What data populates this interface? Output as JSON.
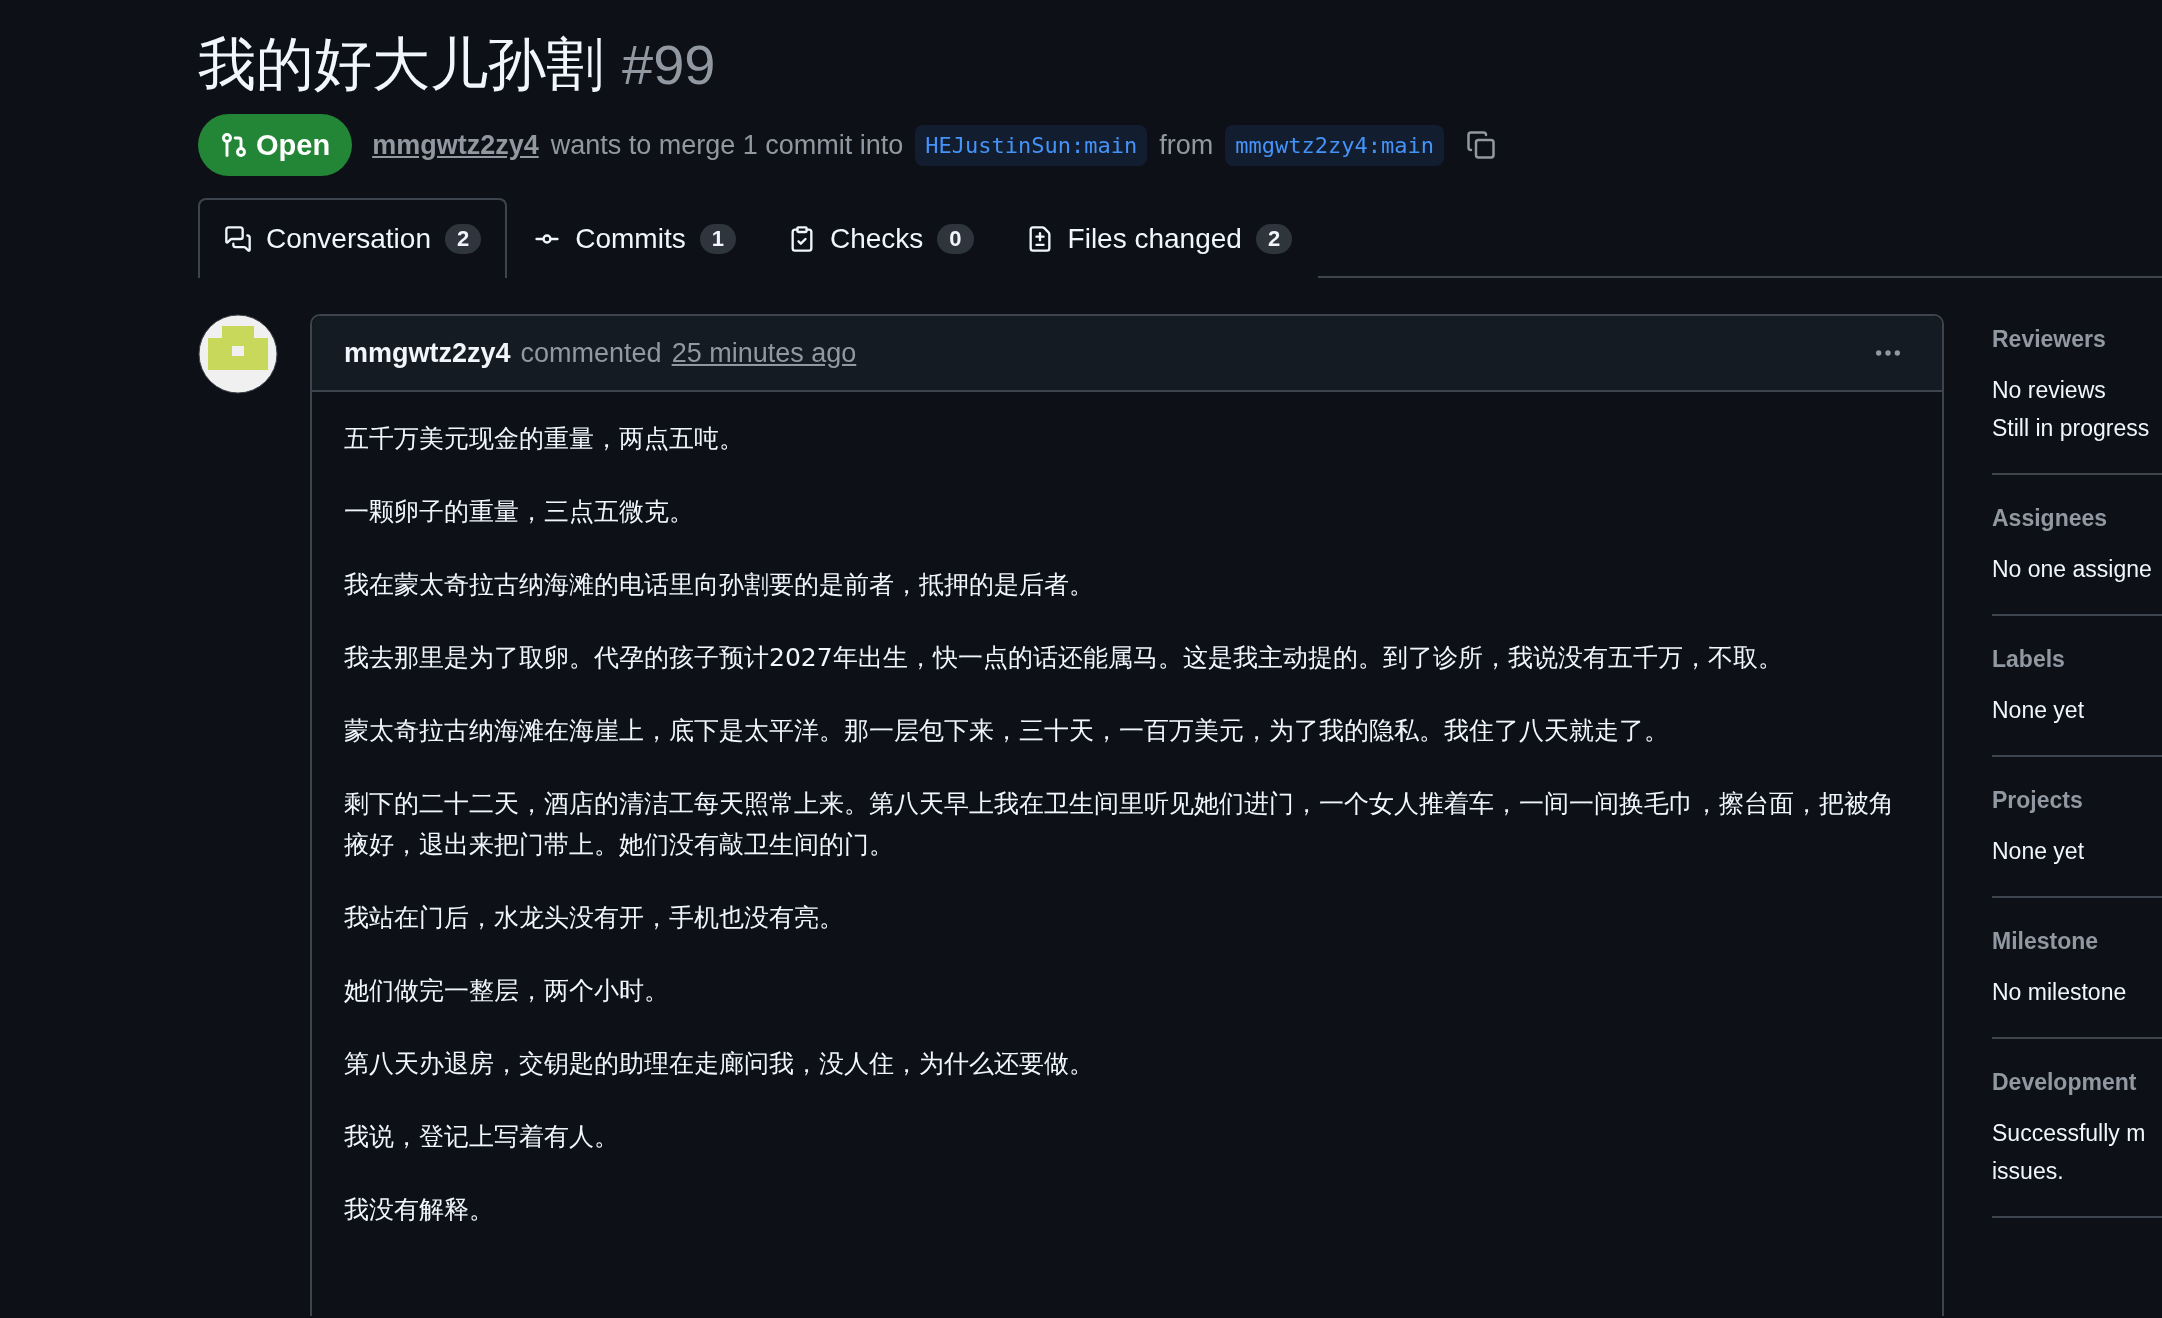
{
  "pull_request": {
    "title": "我的好大儿孙割",
    "number": "#99",
    "state": "Open",
    "author": "mmgwtz2zy4",
    "summary": "wants to merge 1 commit into",
    "base_branch": "HEJustinSun:main",
    "from_label": "from",
    "head_branch": "mmgwtz2zy4:main"
  },
  "tabs": [
    {
      "kind": "conversation",
      "label": "Conversation",
      "count": "2",
      "selected": true
    },
    {
      "kind": "commits",
      "label": "Commits",
      "count": "1",
      "selected": false
    },
    {
      "kind": "checks",
      "label": "Checks",
      "count": "0",
      "selected": false
    },
    {
      "kind": "files",
      "label": "Files changed",
      "count": "2",
      "selected": false
    }
  ],
  "comment": {
    "author": "mmgwtz2zy4",
    "action": "commented",
    "time": "25 minutes ago",
    "paragraphs": [
      "五千万美元现金的重量，两点五吨。",
      "一颗卵子的重量，三点五微克。",
      "我在蒙太奇拉古纳海滩的电话里向孙割要的是前者，抵押的是后者。",
      "我去那里是为了取卵。代孕的孩子预计2027年出生，快一点的话还能属马。这是我主动提的。到了诊所，我说没有五千万，不取。",
      "蒙太奇拉古纳海滩在海崖上，底下是太平洋。那一层包下来，三十天，一百万美元，为了我的隐私。我住了八天就走了。",
      "剩下的二十二天，酒店的清洁工每天照常上来。第八天早上我在卫生间里听见她们进门，一个女人推着车，一间一间换毛巾，擦台面，把被角掖好，退出来把门带上。她们没有敲卫生间的门。",
      "我站在门后，水龙头没有开，手机也没有亮。",
      "她们做完一整层，两个小时。",
      "第八天办退房，交钥匙的助理在走廊问我，没人住，为什么还要做。",
      "我说，登记上写着有人。",
      "我没有解释。"
    ]
  },
  "sidebar": [
    {
      "heading": "Reviewers",
      "lines": [
        "No reviews",
        "Still in progress"
      ]
    },
    {
      "heading": "Assignees",
      "lines": [
        "No one assigne"
      ]
    },
    {
      "heading": "Labels",
      "lines": [
        "None yet"
      ]
    },
    {
      "heading": "Projects",
      "lines": [
        "None yet"
      ]
    },
    {
      "heading": "Milestone",
      "lines": [
        "No milestone"
      ]
    },
    {
      "heading": "Development",
      "lines": [
        "Successfully m",
        "issues."
      ]
    }
  ]
}
